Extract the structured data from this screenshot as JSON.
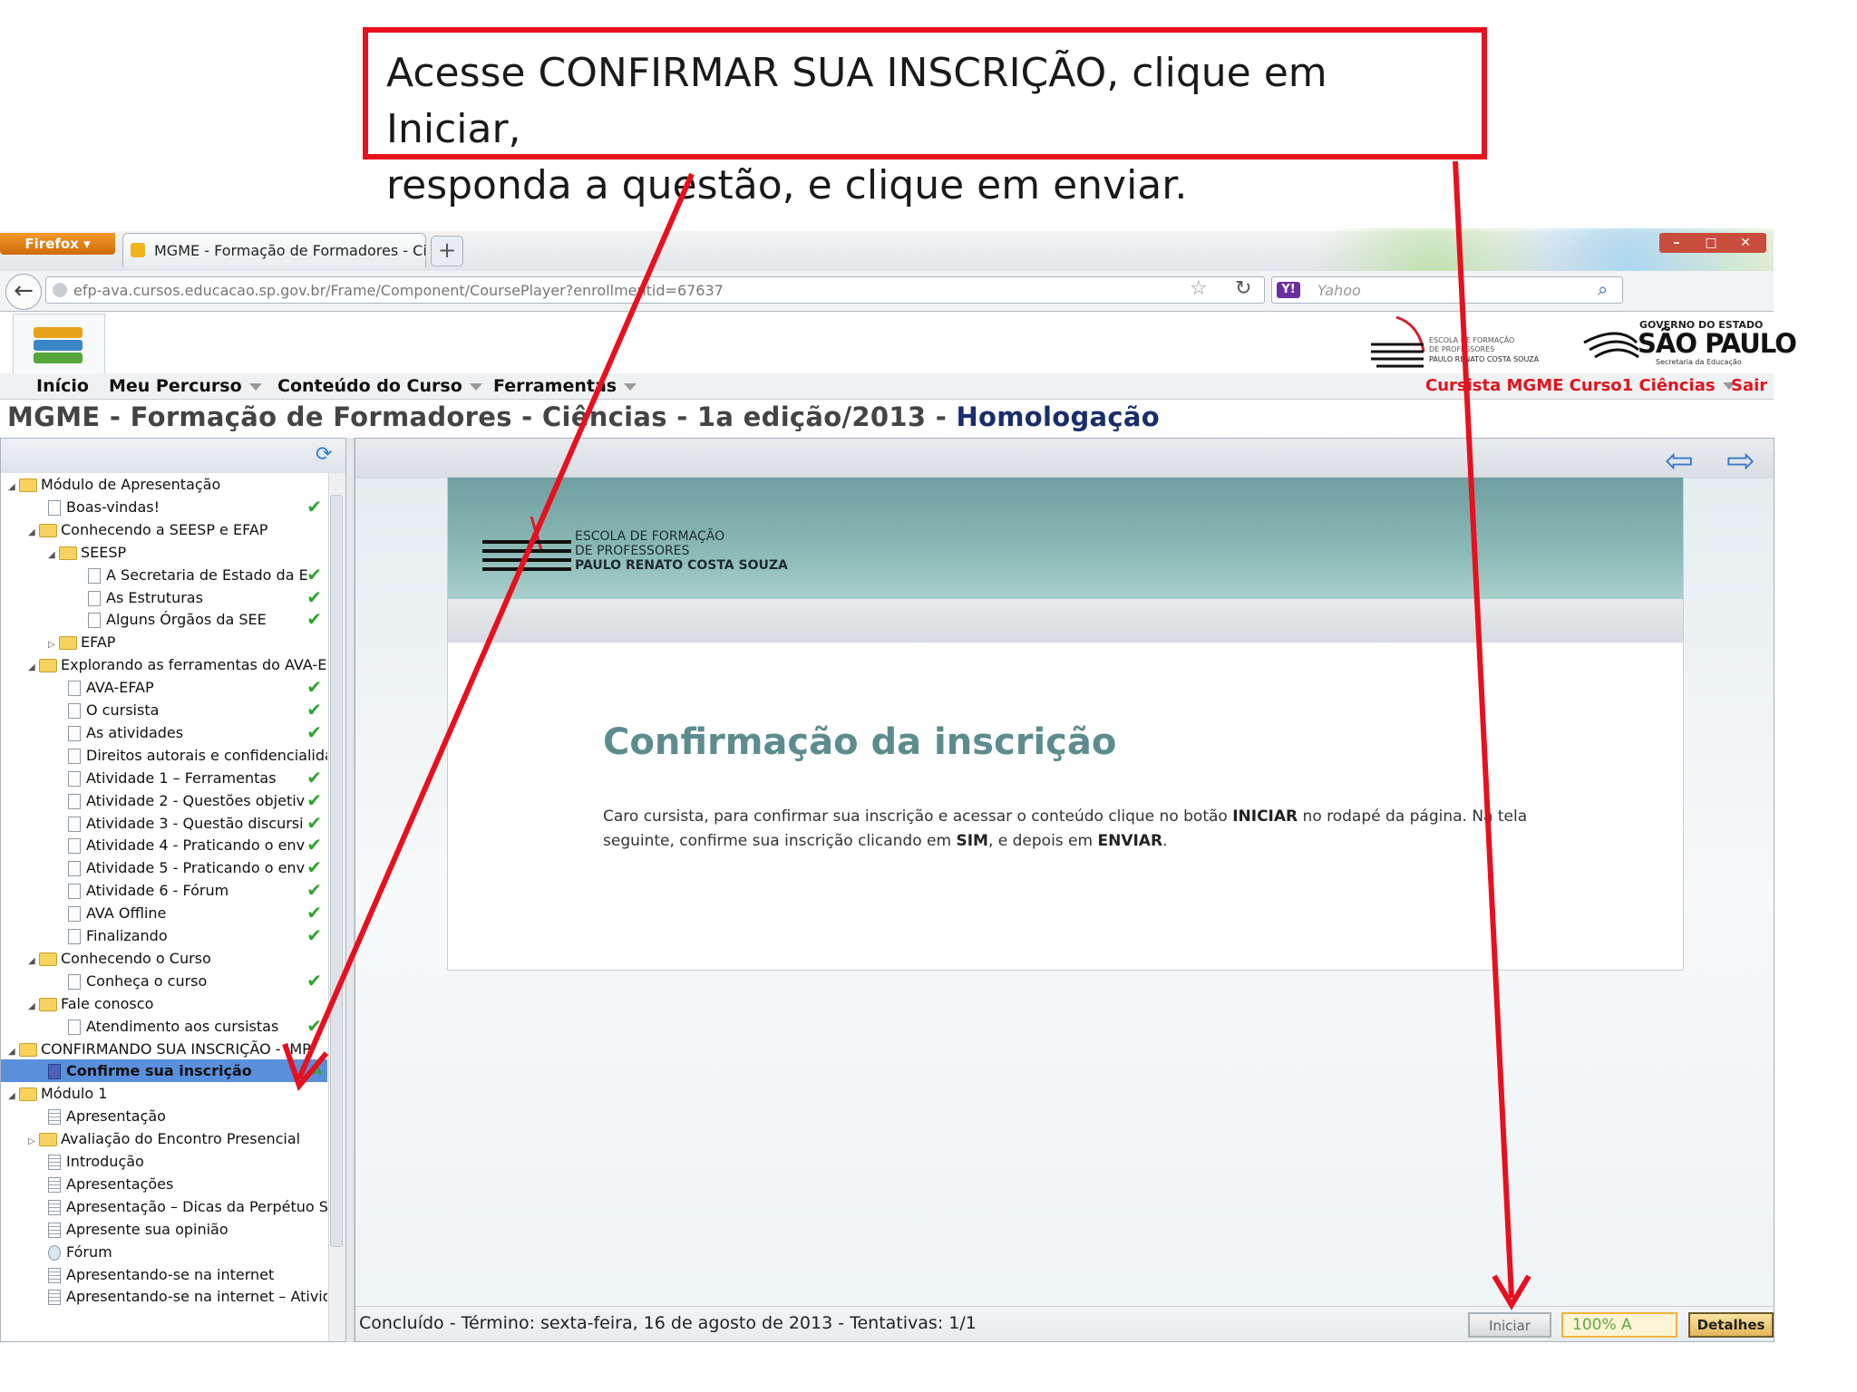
{
  "callout": {
    "line1": "Acesse CONFIRMAR SUA INSCRIÇÃO, clique em Iniciar,",
    "line2": "responda a questão, e clique em enviar."
  },
  "browser": {
    "firefox_label": "Firefox",
    "tab_title": "MGME - Formação de Formadores - Ciê...",
    "new_tab": "+",
    "url": "efp-ava.cursos.educacao.sp.gov.br/Frame/Component/CoursePlayer?enrollmentid=67637",
    "search_placeholder": "Yahoo",
    "yahoo_label": "Y!",
    "window_buttons": [
      "–",
      "□",
      "✕"
    ]
  },
  "logos": {
    "efap_lines": [
      "ESCOLA DE FORMAÇÃO",
      "DE PROFESSORES",
      "PAULO RENATO COSTA SOUZA"
    ],
    "sp_gov": "GOVERNO DO ESTADO",
    "sp_name": "SÃO PAULO",
    "sp_sec": "Secretaria da Educação"
  },
  "menu": {
    "inicio": "Início",
    "meu_percurso": "Meu Percurso",
    "conteudo": "Conteúdo do Curso",
    "ferramentas": "Ferramentas",
    "user": "Cursista MGME Curso1 Ciências",
    "sair": "Sair"
  },
  "course": {
    "title": "MGME - Formação de Formadores - Ciências - 1a edição/2013 - ",
    "env": "Homologação"
  },
  "tree": [
    {
      "label": "Módulo de Apresentação",
      "type": "folder",
      "level": 0,
      "open": true,
      "check": false
    },
    {
      "label": "Boas-vindas!",
      "type": "page",
      "level": 2,
      "check": true
    },
    {
      "label": "Conhecendo a SEESP e EFAP",
      "type": "folder",
      "level": 1,
      "open": true,
      "check": false
    },
    {
      "label": "SEESP",
      "type": "folder",
      "level": 2,
      "open": true,
      "check": false
    },
    {
      "label": "A Secretaria de Estado da E",
      "type": "page",
      "level": 4,
      "check": true
    },
    {
      "label": "As Estruturas",
      "type": "page",
      "level": 4,
      "check": true
    },
    {
      "label": "Alguns Órgãos da SEE",
      "type": "page",
      "level": 4,
      "check": true
    },
    {
      "label": "EFAP",
      "type": "folder",
      "level": 2,
      "open": false,
      "check": false
    },
    {
      "label": "Explorando as ferramentas do AVA-E",
      "type": "folder",
      "level": 1,
      "open": true,
      "check": false
    },
    {
      "label": "AVA-EFAP",
      "type": "page",
      "level": 3,
      "check": true
    },
    {
      "label": "O cursista",
      "type": "page",
      "level": 3,
      "check": true
    },
    {
      "label": "As atividades",
      "type": "page",
      "level": 3,
      "check": true
    },
    {
      "label": "Direitos autorais e confidencialida",
      "type": "page",
      "level": 3,
      "check": false
    },
    {
      "label": "Atividade 1 – Ferramentas",
      "type": "page",
      "level": 3,
      "check": true
    },
    {
      "label": "Atividade 2 - Questões objetiv",
      "type": "page",
      "level": 3,
      "check": true
    },
    {
      "label": "Atividade 3 - Questão discursi",
      "type": "page",
      "level": 3,
      "check": true
    },
    {
      "label": "Atividade 4 - Praticando o env",
      "type": "page",
      "level": 3,
      "check": true
    },
    {
      "label": "Atividade 5 - Praticando o env",
      "type": "page",
      "level": 3,
      "check": true
    },
    {
      "label": "Atividade 6 - Fórum",
      "type": "page",
      "level": 3,
      "check": true
    },
    {
      "label": "AVA Offline",
      "type": "page",
      "level": 3,
      "check": true
    },
    {
      "label": "Finalizando",
      "type": "page",
      "level": 3,
      "check": true
    },
    {
      "label": "Conhecendo o Curso",
      "type": "folder",
      "level": 1,
      "open": true,
      "check": false
    },
    {
      "label": "Conheça o curso",
      "type": "page",
      "level": 3,
      "check": true
    },
    {
      "label": "Fale conosco",
      "type": "folder",
      "level": 1,
      "open": true,
      "check": false
    },
    {
      "label": "Atendimento aos cursistas",
      "type": "page",
      "level": 3,
      "check": true
    },
    {
      "label": "CONFIRMANDO SUA INSCRIÇÃO - IMP",
      "type": "folder",
      "level": 0,
      "open": true,
      "check": false
    },
    {
      "label": "Confirme sua inscrição",
      "type": "quiz",
      "level": 2,
      "check": false,
      "selected": true,
      "mark": "A"
    },
    {
      "label": "Módulo 1",
      "type": "folder",
      "level": 0,
      "open": true,
      "check": false
    },
    {
      "label": "Apresentação",
      "type": "doc",
      "level": 2,
      "check": false
    },
    {
      "label": "Avaliação do Encontro Presencial",
      "type": "folder",
      "level": 1,
      "open": false,
      "check": false
    },
    {
      "label": "Introdução",
      "type": "doc",
      "level": 2,
      "check": false
    },
    {
      "label": "Apresentações",
      "type": "doc",
      "level": 2,
      "check": false
    },
    {
      "label": "Apresentação – Dicas da Perpétuo S",
      "type": "doc",
      "level": 2,
      "check": false
    },
    {
      "label": "Apresente sua opinião",
      "type": "doc",
      "level": 2,
      "check": false
    },
    {
      "label": "Fórum",
      "type": "forum",
      "level": 2,
      "check": false
    },
    {
      "label": "Apresentando-se na internet",
      "type": "doc",
      "level": 2,
      "check": false
    },
    {
      "label": "Apresentando-se na internet – Ativid",
      "type": "doc",
      "level": 2,
      "check": false
    }
  ],
  "content": {
    "banner_lines": [
      "ESCOLA DE FORMAÇÃO",
      "DE PROFESSORES",
      "PAULO RENATO COSTA SOUZA"
    ],
    "title": "Confirmação da inscrição",
    "body_1": "Caro cursista, para confirmar sua inscrição e acessar o conteúdo clique no botão ",
    "body_b1": "INICIAR",
    "body_2": " no rodapé da página. Na tela seguinte, confirme sua inscrição clicando em ",
    "body_b2": "SIM",
    "body_3": ", e depois em ",
    "body_b3": "ENVIAR",
    "body_4": "."
  },
  "status": {
    "text": "Concluído - Término: sexta-feira, 16 de agosto de 2013 - Tentativas: 1/1",
    "iniciar": "Iniciar",
    "progress": "100%   A",
    "detalhes": "Detalhes"
  },
  "colors": {
    "annotation_red": "#e8101e",
    "teal_title": "#5d8c8f",
    "selection": "#5a8fdc"
  }
}
